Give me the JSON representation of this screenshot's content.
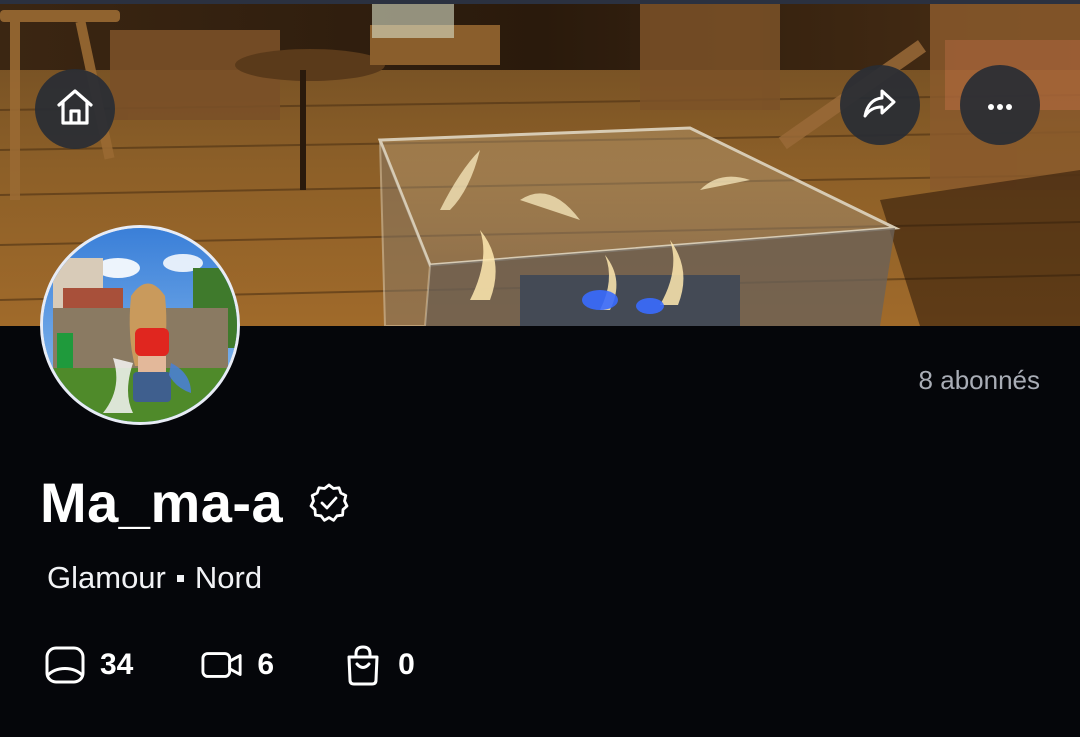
{
  "profile": {
    "name": "Ma_ma-a",
    "followers": "8 abonnés",
    "category": "Glamour",
    "region": "Nord"
  },
  "stats": [
    {
      "icon": "photo-frame-icon",
      "value": "34"
    },
    {
      "icon": "video-camera-icon",
      "value": "6"
    },
    {
      "icon": "shopping-bag-icon",
      "value": "0"
    }
  ],
  "header_buttons": {
    "home": "home-icon",
    "share": "share-icon",
    "more": "more-icon"
  },
  "colors": {
    "background": "#05060a",
    "button_bg": "#282c34",
    "muted_text": "#a9adb6",
    "avatar_border": "#e8ecf5"
  }
}
